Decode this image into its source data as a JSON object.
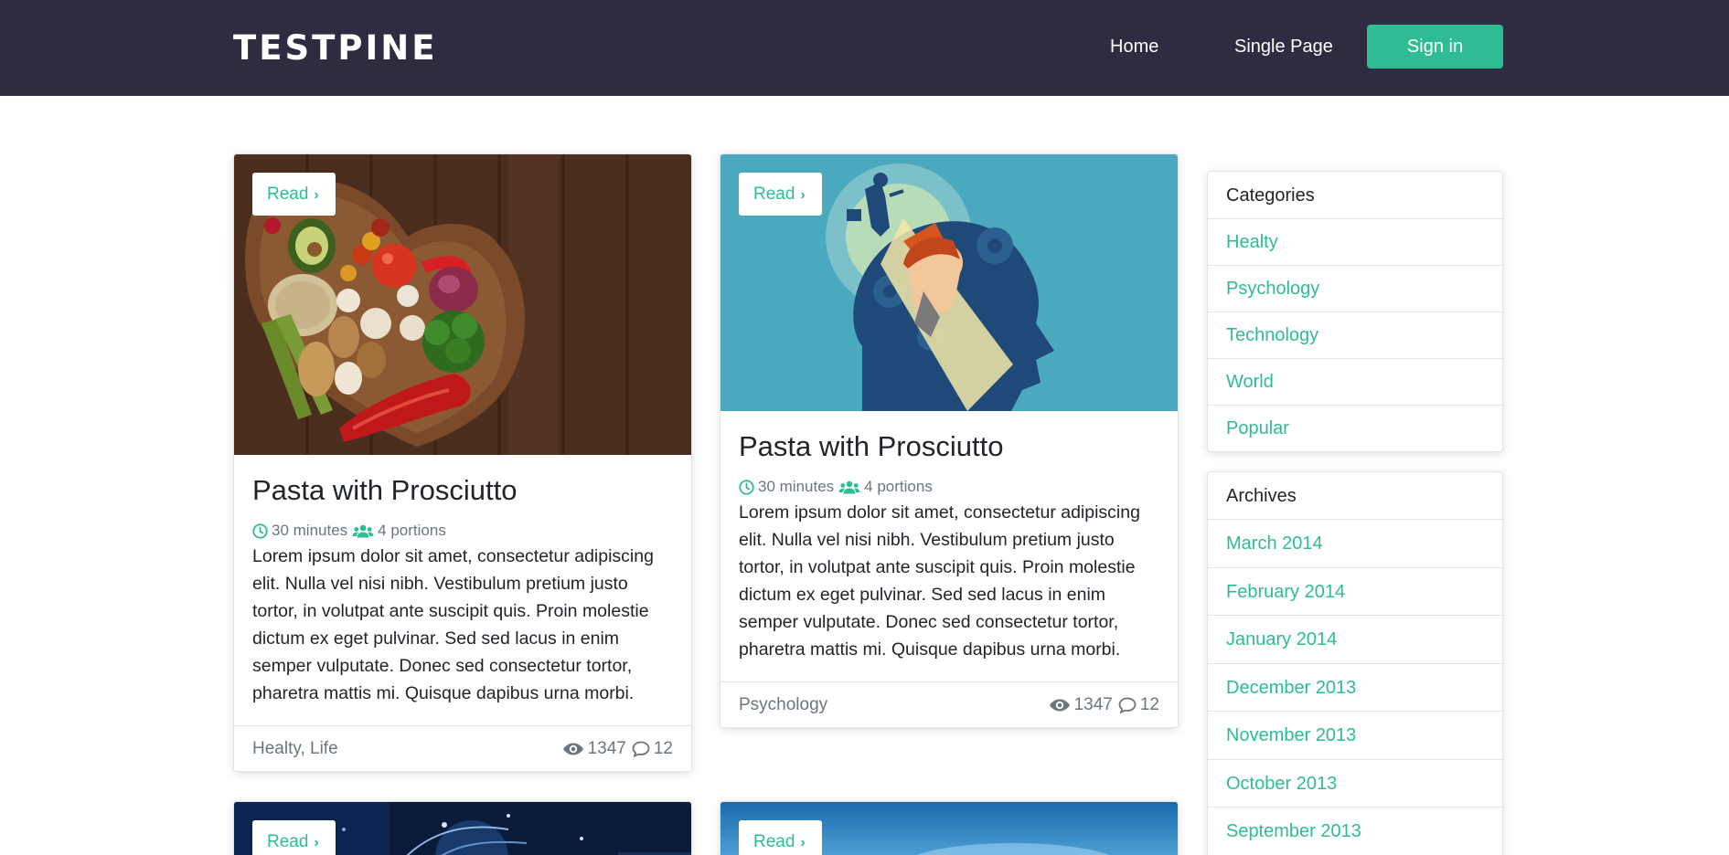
{
  "header": {
    "logo": "TESTPINE",
    "nav": {
      "home": "Home",
      "single_page": "Single Page",
      "sign_in": "Sign in"
    }
  },
  "posts": [
    {
      "read_label": "Read",
      "title": "Pasta with Prosciutto",
      "time": "30 minutes",
      "portions": "4 portions",
      "excerpt": "Lorem ipsum dolor sit amet, consectetur adipiscing elit. Nulla vel nisi nibh. Vestibulum pretium justo tortor, in volutpat ante suscipit quis. Proin molestie dictum ex eget pulvinar. Sed sed lacus in enim semper vulputate. Donec sed consectetur tortor, pharetra mattis mi. Quisque dapibus urna morbi.",
      "categories": "Healty, Life",
      "views": "1347",
      "comments": "12",
      "image": "food-heart-plate-image"
    },
    {
      "read_label": "Read",
      "title": "Pasta with Prosciutto",
      "time": "30 minutes",
      "portions": "4 portions",
      "excerpt": "Lorem ipsum dolor sit amet, consectetur adipiscing elit. Nulla vel nisi nibh. Vestibulum pretium justo tortor, in volutpat ante suscipit quis. Proin molestie dictum ex eget pulvinar. Sed sed lacus in enim semper vulputate. Donec sed consectetur tortor, pharetra mattis mi. Quisque dapibus urna morbi.",
      "categories": "Psychology",
      "views": "1347",
      "comments": "12",
      "image": "head-illustration-image"
    },
    {
      "read_label": "Read",
      "image": "tech-network-image"
    },
    {
      "read_label": "Read",
      "image": "blue-sky-image"
    }
  ],
  "sidebar": {
    "categories": {
      "title": "Categories",
      "items": [
        "Healty",
        "Psychology",
        "Technology",
        "World",
        "Popular"
      ]
    },
    "archives": {
      "title": "Archives",
      "items": [
        "March 2014",
        "February 2014",
        "January 2014",
        "December 2013",
        "November 2013",
        "October 2013",
        "September 2013"
      ]
    }
  },
  "colors": {
    "navbar": "#2d2c40",
    "accent": "#2ebc94",
    "muted": "#6c757d"
  }
}
